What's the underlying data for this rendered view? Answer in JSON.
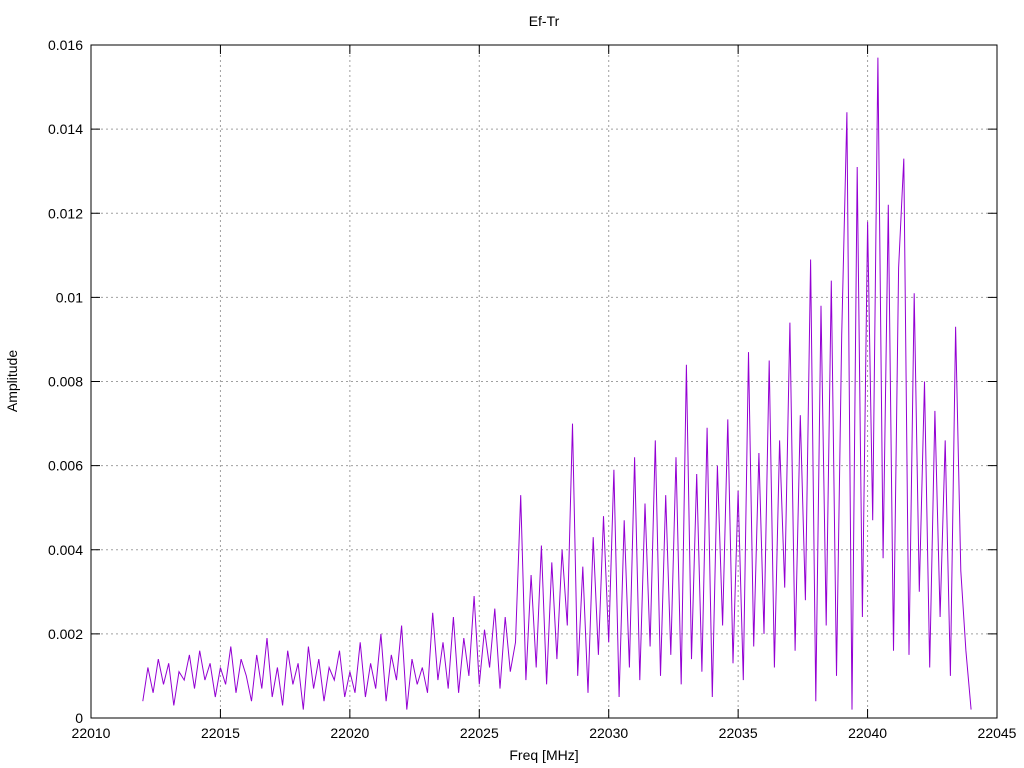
{
  "chart_data": {
    "type": "line",
    "title": "Ef-Tr",
    "xlabel": "Freq [MHz]",
    "ylabel": "Amplitude",
    "xlim": [
      22010,
      22045
    ],
    "ylim": [
      0,
      0.016
    ],
    "xticks": [
      "22010",
      "22015",
      "22020",
      "22025",
      "22030",
      "22035",
      "22040",
      "22045"
    ],
    "yticks": [
      "0",
      "0.002",
      "0.004",
      "0.006",
      "0.008",
      "0.01",
      "0.012",
      "0.014",
      "0.016"
    ],
    "grid": true,
    "legend": "none",
    "series": [
      {
        "name": "Ef-Tr",
        "color": "#9400d3",
        "x_start": 22012.0,
        "x_step": 0.2,
        "values": [
          0.0004,
          0.0012,
          0.0006,
          0.0014,
          0.0008,
          0.0013,
          0.0003,
          0.0011,
          0.0009,
          0.0015,
          0.0007,
          0.0016,
          0.0009,
          0.0013,
          0.0005,
          0.0012,
          0.0008,
          0.0017,
          0.0006,
          0.0014,
          0.001,
          0.0004,
          0.0015,
          0.0007,
          0.0019,
          0.0005,
          0.0012,
          0.0003,
          0.0016,
          0.0008,
          0.0013,
          0.0002,
          0.0017,
          0.0007,
          0.0014,
          0.0004,
          0.0012,
          0.0009,
          0.0016,
          0.0005,
          0.0011,
          0.0006,
          0.0018,
          0.0005,
          0.0013,
          0.0007,
          0.002,
          0.0004,
          0.0015,
          0.0009,
          0.0022,
          0.0002,
          0.0014,
          0.0008,
          0.0012,
          0.0006,
          0.0025,
          0.0009,
          0.0018,
          0.0007,
          0.0024,
          0.0006,
          0.0019,
          0.001,
          0.0029,
          0.0008,
          0.0021,
          0.0012,
          0.0026,
          0.0007,
          0.0024,
          0.0011,
          0.0018,
          0.0053,
          0.0009,
          0.0034,
          0.0012,
          0.0041,
          0.0008,
          0.0037,
          0.0014,
          0.004,
          0.0022,
          0.007,
          0.001,
          0.0036,
          0.0006,
          0.0043,
          0.0015,
          0.0048,
          0.0018,
          0.0059,
          0.0005,
          0.0047,
          0.0012,
          0.0062,
          0.0009,
          0.0051,
          0.0017,
          0.0066,
          0.001,
          0.0053,
          0.0015,
          0.0062,
          0.0008,
          0.0084,
          0.0014,
          0.0058,
          0.0011,
          0.0069,
          0.0005,
          0.006,
          0.0022,
          0.0071,
          0.0013,
          0.0054,
          0.0009,
          0.0087,
          0.0017,
          0.0063,
          0.002,
          0.0085,
          0.0012,
          0.0066,
          0.0031,
          0.0094,
          0.0016,
          0.0072,
          0.0028,
          0.0109,
          0.0004,
          0.0098,
          0.0022,
          0.0104,
          0.001,
          0.0091,
          0.0144,
          0.0002,
          0.0131,
          0.0024,
          0.0118,
          0.0047,
          0.0157,
          0.0038,
          0.0122,
          0.0016,
          0.0107,
          0.0133,
          0.0015,
          0.0101,
          0.003,
          0.008,
          0.0012,
          0.0073,
          0.0024,
          0.0066,
          0.001,
          0.0093,
          0.0035,
          0.0016,
          0.0002
        ]
      }
    ]
  }
}
